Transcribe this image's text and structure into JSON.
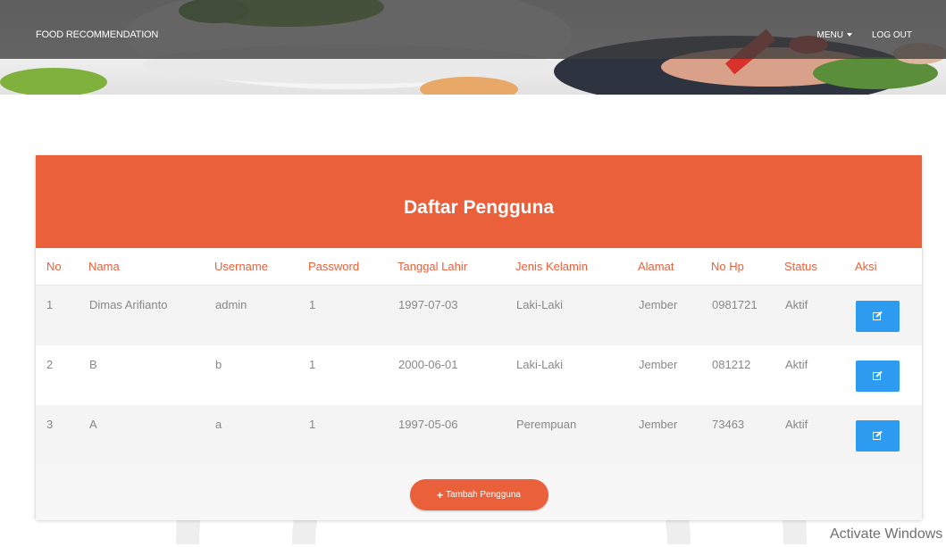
{
  "navbar": {
    "brand": "FOOD RECOMMENDATION",
    "menu_label": "MENU",
    "logout_label": "LOG OUT"
  },
  "card": {
    "title": "Daftar Pengguna",
    "columns": [
      "No",
      "Nama",
      "Username",
      "Password",
      "Tanggal Lahir",
      "Jenis Kelamin",
      "Alamat",
      "No Hp",
      "Status",
      "Aksi"
    ],
    "rows": [
      {
        "no": "1",
        "nama": "Dimas Arifianto",
        "username": "admin",
        "password": "1",
        "tanggal_lahir": "1997-07-03",
        "jenis_kelamin": "Laki-Laki",
        "alamat": "Jember",
        "no_hp": "0981721",
        "status": "Aktif"
      },
      {
        "no": "2",
        "nama": "B",
        "username": "b",
        "password": "1",
        "tanggal_lahir": "2000-06-01",
        "jenis_kelamin": "Laki-Laki",
        "alamat": "Jember",
        "no_hp": "081212",
        "status": "Aktif"
      },
      {
        "no": "3",
        "nama": "A",
        "username": "a",
        "password": "1",
        "tanggal_lahir": "1997-05-06",
        "jenis_kelamin": "Perempuan",
        "alamat": "Jember",
        "no_hp": "73463",
        "status": "Aktif"
      }
    ],
    "add_button_label": "Tambah Pengguna"
  },
  "os_overlay": {
    "activate_text": "Activate Windows"
  },
  "colors": {
    "accent": "#e9603b",
    "edit_button": "#2d9cf0",
    "navbar": "#3c3c3c"
  },
  "icons": {
    "edit": "edit-icon",
    "plus": "plus-icon",
    "caret": "caret-down-icon"
  }
}
